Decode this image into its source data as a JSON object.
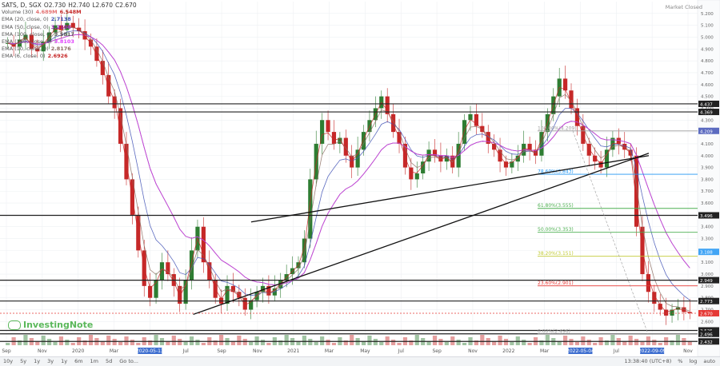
{
  "legend": {
    "symbol": "SATS, D, SGX",
    "ohlc": [
      "O2.730",
      "H2.740",
      "L2.670",
      "C2.670"
    ],
    "rows": [
      {
        "label": "Volume (30)",
        "v1": "4.689M",
        "v2": "6.548M",
        "color": "#e57373"
      },
      {
        "label": "EMA (20, close, 0)",
        "v1": "2.7138",
        "v2": "",
        "color": "#3f51b5"
      },
      {
        "label": "EMA (50, close, 0)",
        "v1": "3.2106",
        "v2": "",
        "color": "#9c27b0"
      },
      {
        "label": "EMA (100, close, 0)",
        "v1": "3.5817",
        "v2": "",
        "color": "#555555"
      },
      {
        "label": "EMA (150, close, 0)",
        "v1": "3.8103",
        "v2": "",
        "color": "#e040fb"
      },
      {
        "label": "EMA (10, close, 0)",
        "v1": "2.8176",
        "v2": "",
        "color": "#8d6e63"
      },
      {
        "label": "EMA (6, close, 0)",
        "v1": "2.6926",
        "v2": "",
        "color": "#c62828"
      }
    ]
  },
  "status_text": "Market Closed",
  "watermark": "InvestingNote",
  "bottom_ranges": [
    "10y",
    "5y",
    "1y",
    "3y",
    "1y",
    "6m",
    "1m",
    "5d",
    "Go to..."
  ],
  "bottom_right": [
    "13:38:40 (UTC+8)",
    "%",
    "log",
    "auto"
  ],
  "chart_data": {
    "type": "candlestick",
    "ylim": [
      2.4,
      5.3
    ],
    "y_ticks": [
      2.5,
      2.6,
      2.7,
      2.8,
      2.9,
      3.0,
      3.1,
      3.2,
      3.3,
      3.4,
      3.5,
      3.6,
      3.7,
      3.8,
      3.9,
      4.0,
      4.1,
      4.2,
      4.3,
      4.4,
      4.5,
      4.6,
      4.7,
      4.8,
      4.9,
      5.0,
      5.1,
      5.2
    ],
    "x_tick_labels": [
      "Sep",
      "Nov",
      "2020",
      "Mar",
      "2020-05-13",
      "Jul",
      "Sep",
      "Nov",
      "2021",
      "Mar",
      "May",
      "Jul",
      "Sep",
      "Nov",
      "2022",
      "Mar",
      "2022-05-04",
      "Jul",
      "2022-09-09",
      "Nov"
    ],
    "price_levels": [
      {
        "value": 4.437,
        "label": "4.437",
        "color": "#222222"
      },
      {
        "value": 4.369,
        "label": "4.369",
        "color": "#222222"
      },
      {
        "value": 3.496,
        "label": "3.496",
        "color": "#222222"
      },
      {
        "value": 2.949,
        "label": "2.949",
        "color": "#222222"
      },
      {
        "value": 2.773,
        "label": "2.773",
        "color": "#222222"
      },
      {
        "value": 2.525,
        "label": "2.525",
        "color": "#222222"
      },
      {
        "value": 2.496,
        "label": "2.496",
        "color": "#222222"
      },
      {
        "value": 2.432,
        "label": "2.432",
        "color": "#222222"
      }
    ],
    "price_badges": [
      {
        "value": 4.209,
        "label": "4.209",
        "color": "#5c6bc0"
      },
      {
        "value": 3.188,
        "label": "3.188",
        "color": "#42a5f5"
      },
      {
        "value": 2.67,
        "label": "2.670",
        "color": "#e53935"
      }
    ],
    "fib_levels": [
      {
        "value": 4.209,
        "label": "100.00%(4.209)",
        "color": "#9e9e9e"
      },
      {
        "value": 3.843,
        "label": "78.60%(3.843)",
        "color": "#2196f3"
      },
      {
        "value": 3.555,
        "label": "61.80%(3.555)",
        "color": "#4caf50"
      },
      {
        "value": 3.353,
        "label": "50.00%(3.353)",
        "color": "#4caf50"
      },
      {
        "value": 3.151,
        "label": "38.20%(3.151)",
        "color": "#c0ca33"
      },
      {
        "value": 2.901,
        "label": "23.60%(2.901)",
        "color": "#e53935"
      },
      {
        "value": 2.496,
        "label": "0.00%(2.496)",
        "color": "#9e9e9e"
      }
    ],
    "candles_close": [
      4.95,
      4.92,
      4.98,
      5.02,
      4.9,
      4.88,
      4.96,
      5.04,
      5.1,
      5.06,
      5.12,
      5.08,
      5.05,
      4.98,
      4.92,
      4.8,
      4.68,
      4.5,
      4.4,
      4.1,
      3.8,
      3.5,
      3.2,
      2.9,
      2.8,
      2.95,
      3.1,
      3.0,
      2.9,
      2.75,
      2.95,
      3.2,
      3.4,
      3.1,
      2.95,
      2.8,
      2.75,
      2.9,
      2.85,
      2.8,
      2.7,
      2.78,
      2.85,
      2.9,
      2.82,
      2.88,
      2.95,
      3.0,
      3.05,
      3.1,
      3.3,
      3.8,
      4.1,
      4.3,
      4.2,
      4.1,
      4.15,
      4.0,
      3.9,
      4.05,
      4.2,
      4.3,
      4.4,
      4.5,
      4.35,
      4.2,
      4.1,
      3.9,
      3.8,
      3.85,
      3.95,
      4.05,
      4.0,
      3.95,
      4.0,
      3.9,
      4.1,
      4.3,
      4.35,
      4.25,
      4.2,
      4.1,
      4.05,
      3.95,
      3.9,
      3.95,
      4.0,
      4.1,
      4.05,
      4.0,
      4.2,
      4.35,
      4.5,
      4.65,
      4.55,
      4.4,
      4.25,
      4.1,
      4.0,
      3.95,
      3.9,
      4.05,
      4.15,
      4.1,
      4.05,
      4.0,
      3.4,
      3.0,
      2.85,
      2.75,
      2.7,
      2.65,
      2.7,
      2.72,
      2.68,
      2.67
    ],
    "trendlines": [
      {
        "x1": 0.277,
        "y1": 2.66,
        "x2": 0.93,
        "y2": 4.02,
        "color": "#111111"
      },
      {
        "x1": 0.36,
        "y1": 3.44,
        "x2": 0.93,
        "y2": 4.0,
        "color": "#111111"
      }
    ]
  }
}
